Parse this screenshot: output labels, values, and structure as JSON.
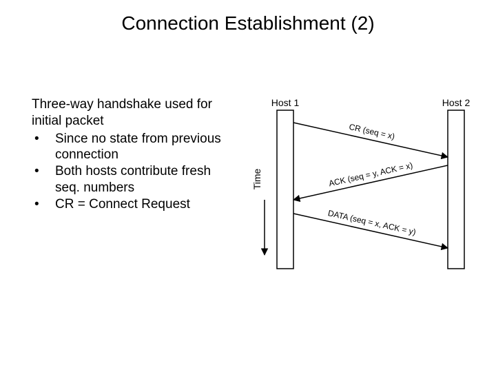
{
  "title": "Connection Establishment (2)",
  "lead": "Three-way handshake used for initial packet",
  "bullets": [
    "Since no state from previous connection",
    "Both hosts contribute fresh seq. numbers",
    "CR = Connect Request"
  ],
  "diagram": {
    "host1": "Host 1",
    "host2": "Host 2",
    "time": "Time",
    "msg1": "CR (seq = x)",
    "msg2": "ACK (seq = y, ACK = x)",
    "msg3": "DATA (seq = x, ACK = y)"
  }
}
